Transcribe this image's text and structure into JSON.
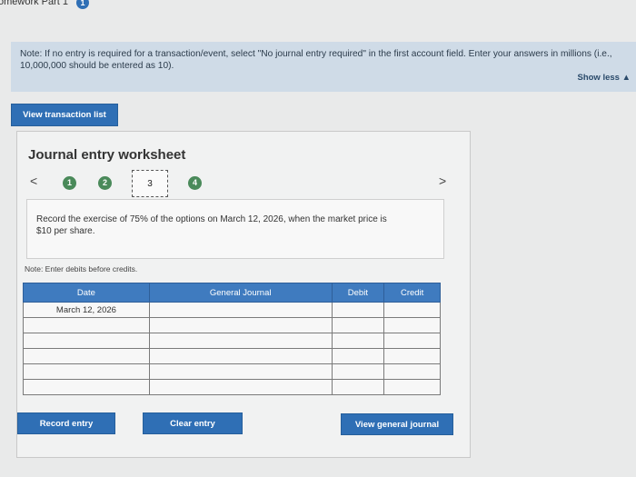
{
  "header": {
    "title": "omework Part 1",
    "badge": "1"
  },
  "note": {
    "text": "Note: If no entry is required for a transaction/event, select \"No journal entry required\" in the first account field. Enter your answers in millions (i.e., 10,000,000 should be entered as 10).",
    "toggle": "Show less ▲"
  },
  "buttons": {
    "view_transactions": "View transaction list",
    "record": "Record entry",
    "clear": "Clear entry",
    "view_journal": "View general journal"
  },
  "worksheet": {
    "title": "Journal entry worksheet",
    "prev": "<",
    "next": ">",
    "steps": [
      "1",
      "2",
      "3",
      "4"
    ],
    "description": "Record the exercise of 75% of the options on March 12, 2026, when the market price is $10 per share.",
    "debit_note": "Note: Enter debits before credits."
  },
  "table": {
    "headers": [
      "Date",
      "General Journal",
      "Debit",
      "Credit"
    ],
    "rows": [
      [
        "March 12, 2026",
        "",
        "",
        ""
      ],
      [
        "",
        "",
        "",
        ""
      ],
      [
        "",
        "",
        "",
        ""
      ],
      [
        "",
        "",
        "",
        ""
      ],
      [
        "",
        "",
        "",
        ""
      ],
      [
        "",
        "",
        "",
        ""
      ]
    ]
  },
  "colors": {
    "accent": "#2f6fb5",
    "note_bg": "#cfdbe7",
    "step_done": "#4a8a5a"
  }
}
